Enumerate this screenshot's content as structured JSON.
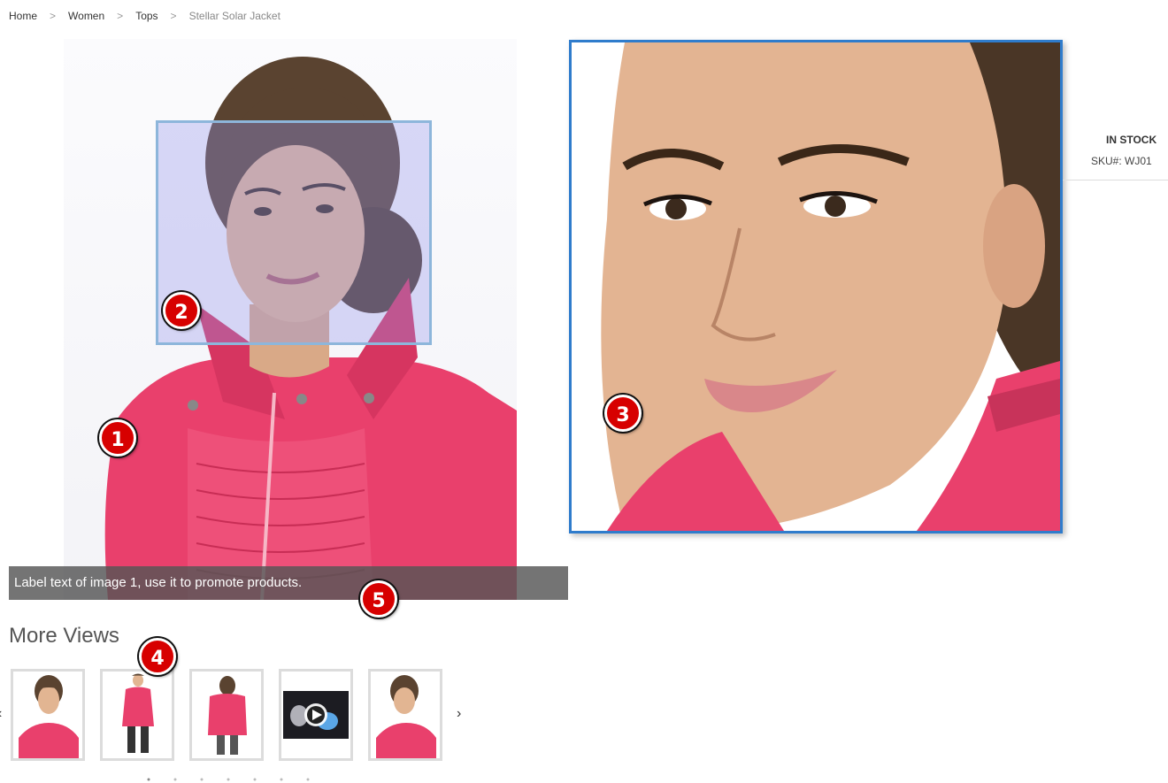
{
  "breadcrumb": {
    "items": [
      "Home",
      "Women",
      "Tops"
    ],
    "current": "Stellar Solar Jacket",
    "separator": ">"
  },
  "main_image": {
    "label_text": "Label text of image 1, use it to promote products."
  },
  "product": {
    "stock": "IN STOCK",
    "sku_label": "SKU#:",
    "sku_value": "WJ01"
  },
  "more_views": {
    "title": "More Views",
    "prev_icon": "‹",
    "next_icon": "›",
    "thumbnails": [
      {
        "kind": "front-closeup"
      },
      {
        "kind": "full-front"
      },
      {
        "kind": "back"
      },
      {
        "kind": "video"
      },
      {
        "kind": "front-closeup-2"
      }
    ]
  },
  "callouts": [
    "1",
    "2",
    "3",
    "4",
    "5"
  ],
  "colors": {
    "jacket_pink": "#e9406c",
    "zoom_border": "#2f7ccc",
    "lens_fill": "#9696eb",
    "badge_red": "#d70000",
    "label_bg": "#555555"
  }
}
